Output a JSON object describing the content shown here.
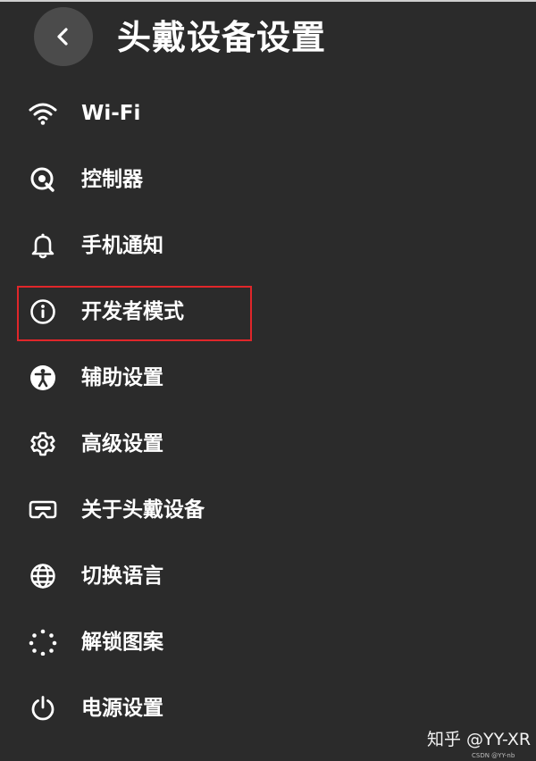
{
  "header": {
    "title": "头戴设备设置",
    "back_icon": "chevron-left-icon"
  },
  "menu": {
    "items": [
      {
        "label": "Wi-Fi",
        "icon": "wifi-icon"
      },
      {
        "label": "控制器",
        "icon": "controller-icon"
      },
      {
        "label": "手机通知",
        "icon": "bell-icon"
      },
      {
        "label": "开发者模式",
        "icon": "info-icon",
        "highlighted": true
      },
      {
        "label": "辅助设置",
        "icon": "accessibility-icon"
      },
      {
        "label": "高级设置",
        "icon": "gear-icon"
      },
      {
        "label": "关于头戴设备",
        "icon": "vr-headset-icon"
      },
      {
        "label": "切换语言",
        "icon": "globe-icon"
      },
      {
        "label": "解锁图案",
        "icon": "unlock-pattern-icon"
      },
      {
        "label": "电源设置",
        "icon": "power-icon"
      }
    ]
  },
  "watermark": {
    "main": "知乎 @YY-XR",
    "small": "CSDN @YY-nb"
  },
  "colors": {
    "background": "#2b2b2b",
    "back_button": "#4b4b4b",
    "text": "#ffffff",
    "highlight": "#e0262a"
  }
}
